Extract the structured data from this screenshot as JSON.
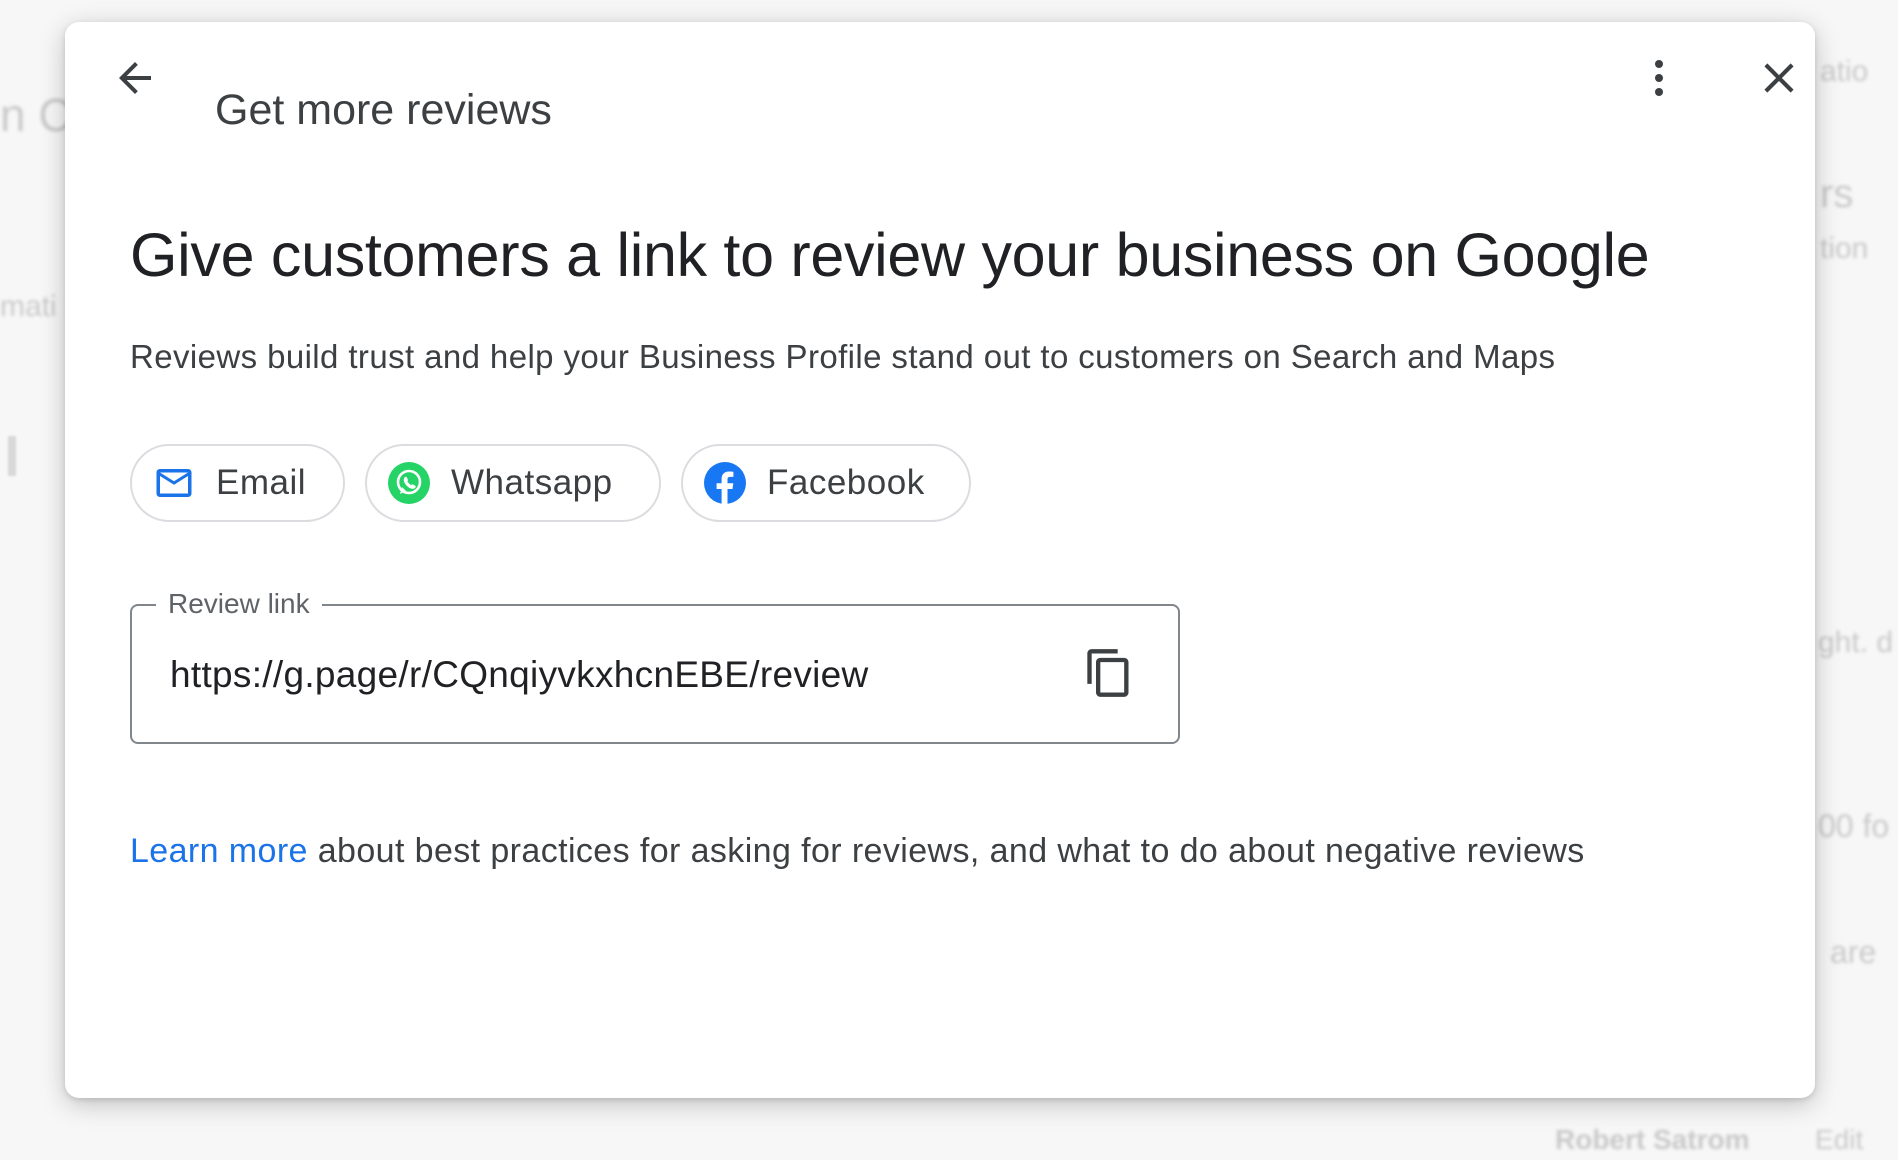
{
  "background": {
    "fragments": [
      "n C",
      "mati",
      "atio",
      "rs",
      "tion",
      "ght. d",
      "00 fo",
      "are",
      "Robert Satrom",
      "Edit"
    ]
  },
  "header": {
    "title": "Get more reviews",
    "back_icon": "arrow-back-icon",
    "more_icon": "more-vert-icon",
    "close_icon": "close-icon"
  },
  "main": {
    "heading": "Give customers a link to review your business on Google",
    "subtext": "Reviews build trust and help your Business Profile stand out to customers on Search and Maps"
  },
  "share_options": [
    {
      "label": "Email",
      "icon": "mail-icon",
      "color": "#1a73e8"
    },
    {
      "label": "Whatsapp",
      "icon": "whatsapp-icon",
      "color": "#25d366"
    },
    {
      "label": "Facebook",
      "icon": "facebook-icon",
      "color": "#1877f2"
    }
  ],
  "review_link": {
    "label": "Review link",
    "value": "https://g.page/r/CQnqiyvkxhcnEBE/review",
    "copy_icon": "copy-icon"
  },
  "footer": {
    "link_text": "Learn more",
    "rest_text": " about best practices for asking for reviews, and what to do about negative reviews"
  },
  "colors": {
    "link": "#1a73e8",
    "text_primary": "#202124",
    "text_secondary": "#3c4043",
    "border": "#dadce0"
  }
}
